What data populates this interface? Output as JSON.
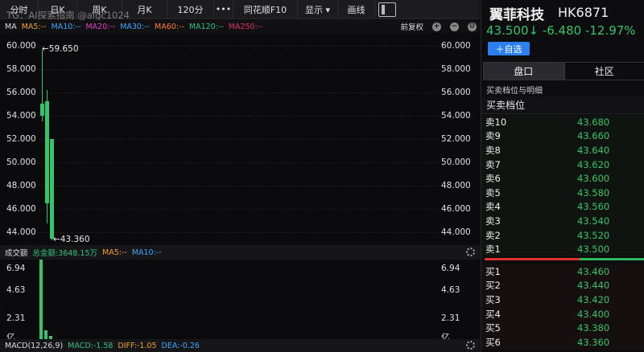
{
  "toolbar": {
    "items": [
      {
        "label": "分时",
        "w": 48
      },
      {
        "label": "日K",
        "w": 48
      },
      {
        "label": "周K",
        "w": 56
      },
      {
        "label": "月K",
        "w": 56
      },
      {
        "label": "120分",
        "w": 58
      },
      {
        "label": "•••",
        "w": 24
      },
      {
        "label": "同花顺F10",
        "w": 80
      },
      {
        "label": "显示 ▾",
        "w": 50
      },
      {
        "label": "画线",
        "w": 46
      }
    ]
  },
  "watermark": "TG：AI探索指南 @aigc1024",
  "ma": {
    "label": "MA",
    "items": [
      {
        "text": "MA5:--",
        "color": "#f0a030"
      },
      {
        "text": "MA10:--",
        "color": "#3aa8ff"
      },
      {
        "text": "MA20:--",
        "color": "#e040c0"
      },
      {
        "text": "MA30:--",
        "color": "#3aa8ff"
      },
      {
        "text": "MA60:--",
        "color": "#ff7a30"
      },
      {
        "text": "MA120:--",
        "color": "#30c080"
      },
      {
        "text": "MA250:--",
        "color": "#e03060"
      }
    ],
    "adjust": "前复权"
  },
  "price_axis": [
    "60.000",
    "58.000",
    "56.000",
    "54.000",
    "52.000",
    "50.000",
    "48.000",
    "46.000",
    "44.000"
  ],
  "annotations": {
    "high": "←59.650",
    "low": "←43.360"
  },
  "volume": {
    "title": "成交额",
    "total": "总金额:3648.15万",
    "ma5": "MA5:--",
    "ma10": "MA10:--",
    "axis": [
      "6.94",
      "4.63",
      "2.31",
      "亿"
    ]
  },
  "macd": {
    "label": "MACD(12,26,9)",
    "macd": "MACD:-1.58",
    "diff": "DIFF:-1.05",
    "dea": "DEA:-0.26"
  },
  "chart_data": {
    "type": "candlestick",
    "price": {
      "candles": [
        {
          "open": 54.0,
          "close": 55.0,
          "high": 59.65,
          "low": 53.5
        },
        {
          "open": 55.2,
          "close": 46.5,
          "high": 56.2,
          "low": 44.8
        },
        {
          "open": 52.0,
          "close": 43.5,
          "high": 52.0,
          "low": 43.36
        }
      ],
      "ylim": [
        43.0,
        61.0
      ]
    },
    "volume": {
      "values": [
        7.3,
        0.8,
        0.3
      ],
      "ylim": [
        0,
        7.3
      ]
    }
  },
  "stock": {
    "name": "翼菲科技",
    "code": "HK6871",
    "price_line": "43.500↓ -6.480 -12.97%",
    "add_label": "＋自选"
  },
  "tabs": [
    "盘口",
    "社区"
  ],
  "subhead": "买卖档位与明细",
  "level_title": "买卖档位",
  "sell": [
    {
      "label": "卖10",
      "price": "43.680"
    },
    {
      "label": "卖9",
      "price": "43.660"
    },
    {
      "label": "卖8",
      "price": "43.640"
    },
    {
      "label": "卖7",
      "price": "43.620"
    },
    {
      "label": "卖6",
      "price": "43.600"
    },
    {
      "label": "卖5",
      "price": "43.580"
    },
    {
      "label": "卖4",
      "price": "43.560"
    },
    {
      "label": "卖3",
      "price": "43.540"
    },
    {
      "label": "卖2",
      "price": "43.520"
    },
    {
      "label": "卖1",
      "price": "43.500"
    }
  ],
  "buy": [
    {
      "label": "买1",
      "price": "43.460"
    },
    {
      "label": "买2",
      "price": "43.440"
    },
    {
      "label": "买3",
      "price": "43.420"
    },
    {
      "label": "买4",
      "price": "43.400"
    },
    {
      "label": "买5",
      "price": "43.380"
    },
    {
      "label": "买6",
      "price": "43.360"
    }
  ],
  "colors": {
    "down": "#36c46a",
    "accent": "#2d7ff0",
    "divider_red": "#e03030",
    "divider_green": "#2fb862"
  }
}
